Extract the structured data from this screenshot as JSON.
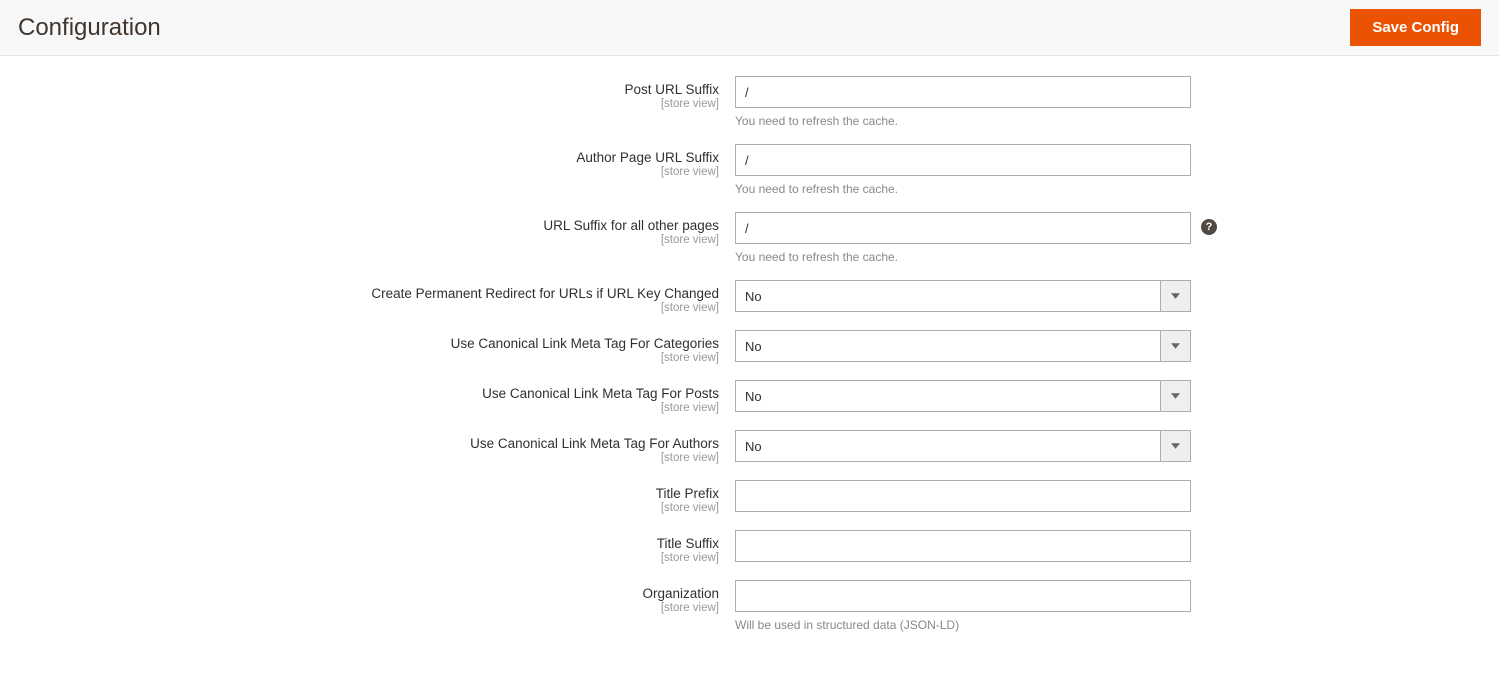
{
  "page": {
    "title": "Configuration",
    "saveLabel": "Save Config"
  },
  "common": {
    "scope": "[store view]",
    "refreshNote": "You need to refresh the cache."
  },
  "fields": {
    "postSuffix": {
      "label": "Post URL Suffix",
      "value": "/"
    },
    "authorSuffix": {
      "label": "Author Page URL Suffix",
      "value": "/"
    },
    "otherSuffix": {
      "label": "URL Suffix for all other pages",
      "value": "/"
    },
    "redirect": {
      "label": "Create Permanent Redirect for URLs if URL Key Changed",
      "value": "No"
    },
    "canonCat": {
      "label": "Use Canonical Link Meta Tag For Categories",
      "value": "No"
    },
    "canonPost": {
      "label": "Use Canonical Link Meta Tag For Posts",
      "value": "No"
    },
    "canonAuth": {
      "label": "Use Canonical Link Meta Tag For Authors",
      "value": "No"
    },
    "titlePrefix": {
      "label": "Title Prefix",
      "value": ""
    },
    "titleSuffix": {
      "label": "Title Suffix",
      "value": ""
    },
    "organization": {
      "label": "Organization",
      "value": "",
      "note": "Will be used in structured data (JSON-LD)"
    }
  },
  "help": {
    "glyph": "?"
  }
}
